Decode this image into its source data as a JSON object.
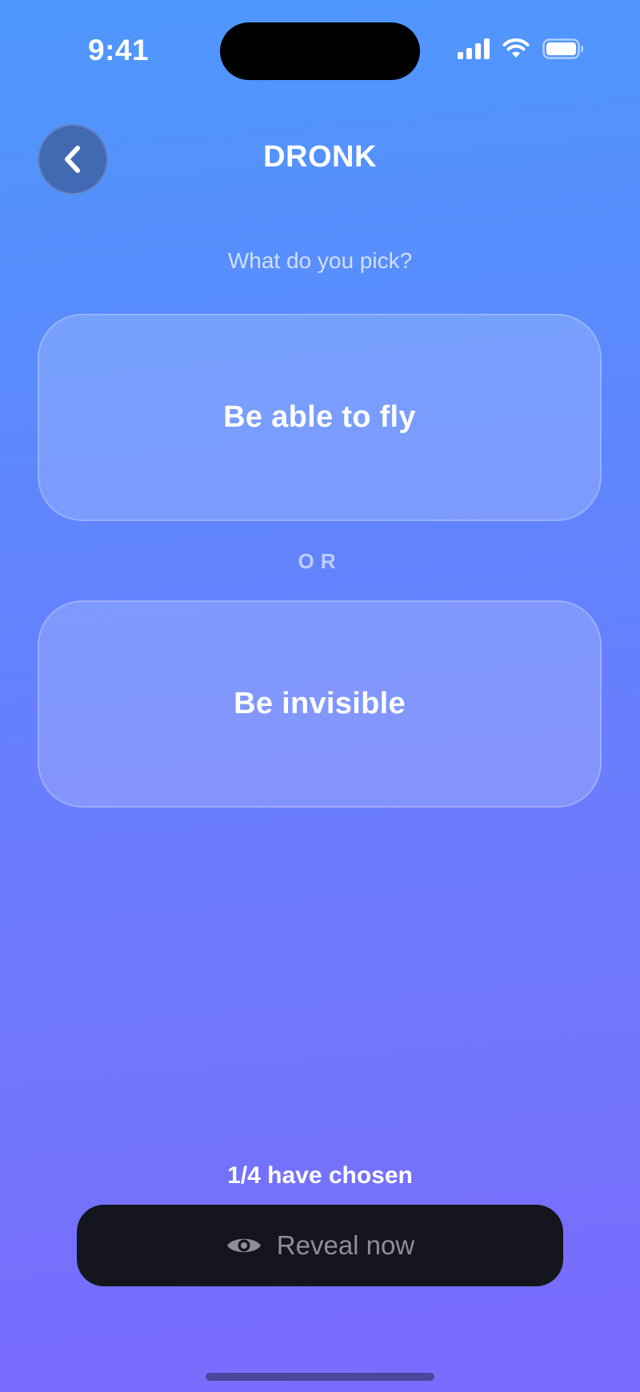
{
  "status_bar": {
    "time": "9:41",
    "icons": [
      "cellular-signal-icon",
      "wifi-icon",
      "battery-icon"
    ]
  },
  "header": {
    "title": "DRONK",
    "back_icon": "chevron-left-icon"
  },
  "question": {
    "prompt": "What do you pick?",
    "option_a": "Be able to fly",
    "divider": "OR",
    "option_b": "Be invisible"
  },
  "footer": {
    "chosen_count": "1/4 have chosen",
    "reveal_label": "Reveal now",
    "reveal_icon": "eye-icon"
  },
  "colors": {
    "gradient_top": "#4e98fd",
    "gradient_bottom": "#7a6afd",
    "button_dark": "#15161d",
    "button_text": "#8e8f97"
  }
}
